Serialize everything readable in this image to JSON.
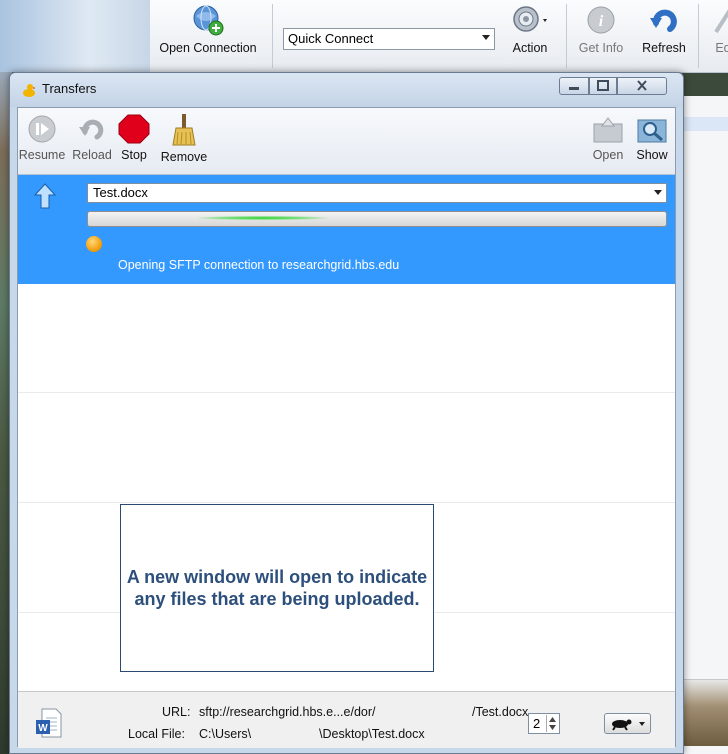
{
  "app": {
    "toolbar": {
      "open_connection": "Open Connection",
      "quick_connect": "Quick Connect",
      "action": "Action",
      "get_info": "Get Info",
      "refresh": "Refresh",
      "edit_partial": "Ed"
    }
  },
  "transfers": {
    "title": "Transfers",
    "toolbar": {
      "resume": "Resume",
      "reload": "Reload",
      "stop": "Stop",
      "remove": "Remove",
      "open": "Open",
      "show": "Show"
    },
    "item": {
      "filename": "Test.docx",
      "status": "Opening SFTP connection to researchgrid.hbs.edu",
      "direction_icon": "upload-arrow-icon"
    },
    "note": "A new window will open to indicate any files that are being uploaded.",
    "footer": {
      "url_label": "URL:",
      "url_value": "sftp://researchgrid.hbs.e...e/dor/",
      "url_file": "/Test.docx",
      "local_label": "Local File:",
      "local_value": "C:\\Users\\",
      "local_file": "\\Desktop\\Test.docx",
      "connections": "2"
    }
  },
  "colors": {
    "selection": "#3399ff",
    "note_text": "#2d4f7b",
    "stop_red": "#e0001b"
  }
}
